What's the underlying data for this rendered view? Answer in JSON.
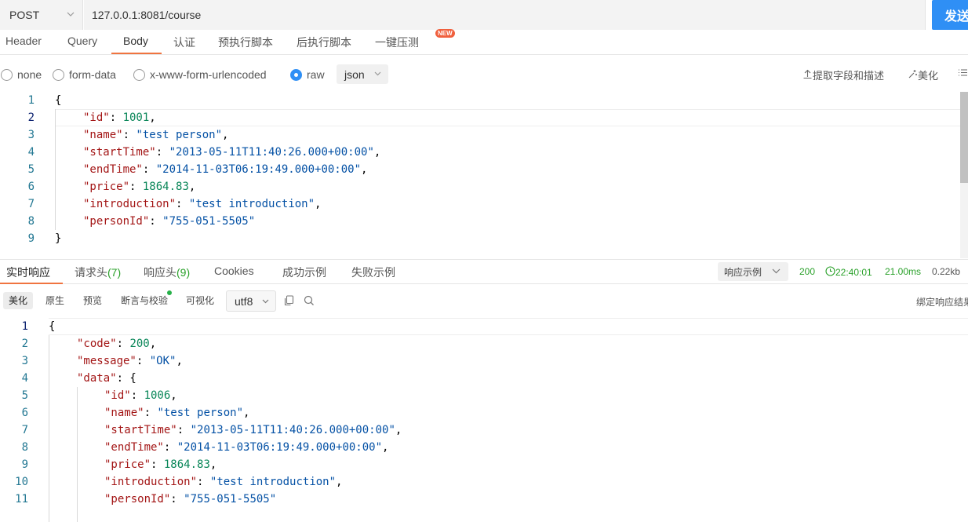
{
  "request": {
    "method": "POST",
    "url": "127.0.0.1:8081/course",
    "send_label": "发送"
  },
  "req_tabs": [
    {
      "label": "Header"
    },
    {
      "label": "Query"
    },
    {
      "label": "Body"
    },
    {
      "label": "认证"
    },
    {
      "label": "预执行脚本"
    },
    {
      "label": "后执行脚本"
    },
    {
      "label": "一键压测"
    }
  ],
  "new_badge": "NEW",
  "body_types": [
    "none",
    "form-data",
    "x-www-form-urlencoded",
    "raw"
  ],
  "body_format": "json",
  "body_tools": {
    "extract": "提取字段和描述",
    "beautify": "美化"
  },
  "request_body": {
    "line_numbers": [
      "1",
      "2",
      "3",
      "4",
      "5",
      "6",
      "7",
      "8",
      "9"
    ],
    "id": "1001",
    "name": "test person",
    "startTime": "2013-05-11T11:40:26.000+00:00",
    "endTime": "2014-11-03T06:19:49.000+00:00",
    "price": "1864.83",
    "introduction": "test introduction",
    "personId": "755-051-5505"
  },
  "resp_tabs": {
    "realtime": "实时响应",
    "req_headers": "请求头",
    "req_headers_count": "(7)",
    "resp_headers": "响应头",
    "resp_headers_count": "(9)",
    "cookies": "Cookies",
    "success_example": "成功示例",
    "fail_example": "失败示例"
  },
  "resp_status": {
    "example_select": "响应示例",
    "code": "200",
    "time": "22:40:01",
    "duration": "21.00ms",
    "size": "0.22kb"
  },
  "resp_tools": {
    "beautify": "美化",
    "raw": "原生",
    "preview": "预览",
    "assert": "断言与校验",
    "visualize": "可视化",
    "encoding": "utf8",
    "bind": "绑定响应结果"
  },
  "response_body": {
    "line_numbers": [
      "1",
      "2",
      "3",
      "4",
      "5",
      "6",
      "7",
      "8",
      "9",
      "10",
      "11"
    ],
    "code": "200",
    "message": "OK",
    "data": {
      "id": "1006",
      "name": "test person",
      "startTime": "2013-05-11T11:40:26.000+00:00",
      "endTime": "2014-11-03T06:19:49.000+00:00",
      "price": "1864.83",
      "introduction": "test introduction",
      "personId": "755-051-5505"
    }
  }
}
